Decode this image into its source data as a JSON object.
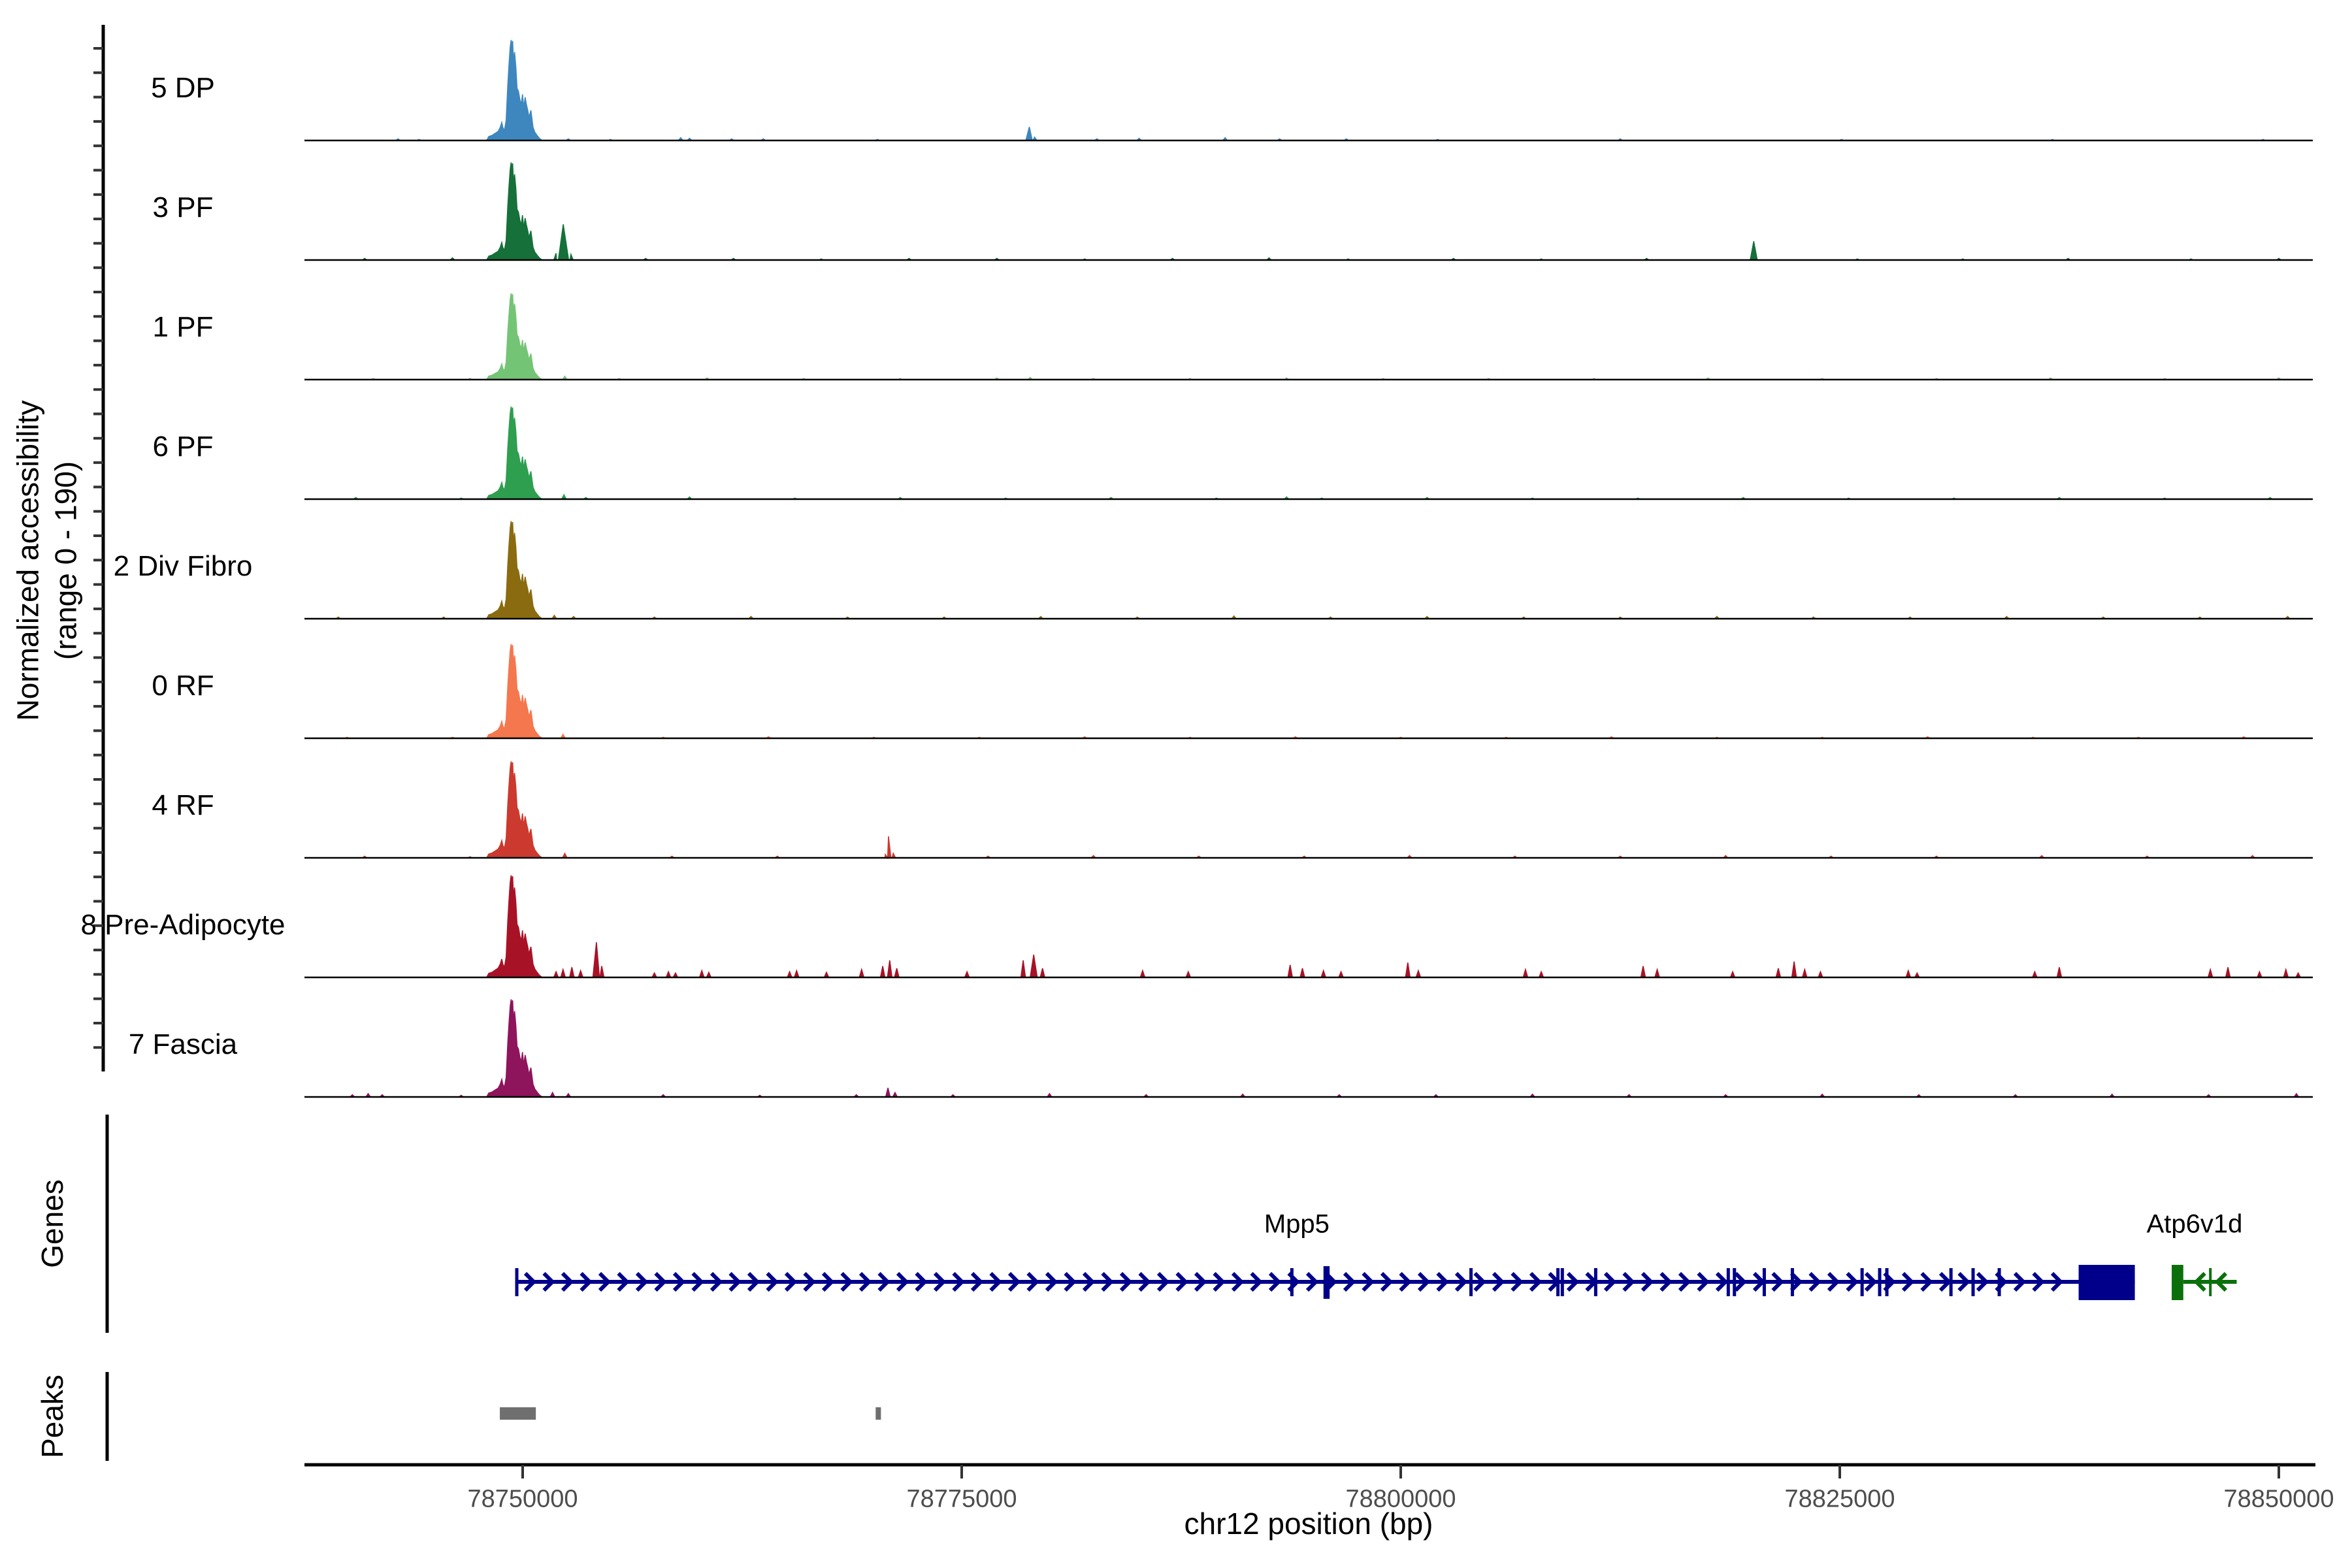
{
  "figure": {
    "background": "#ffffff"
  },
  "y_axis": {
    "title_line1": "Normalized accessibility",
    "title_line2": "(range 0 - 190)",
    "range_min": 0,
    "range_max": 190
  },
  "x_axis": {
    "title": "chr12 position (bp)",
    "tick_labels": [
      "78750000",
      "78775000",
      "78800000",
      "78825000",
      "78850000"
    ]
  },
  "sections": {
    "genes": "Genes",
    "peaks": "Peaks"
  },
  "chart_data": {
    "type": "area",
    "title": "",
    "xlabel": "chr12 position (bp)",
    "ylabel": "Normalized accessibility (range 0 - 190)",
    "xlim": [
      78737574,
      78851934
    ],
    "track_ylim": [
      0,
      190
    ],
    "x_ticks": [
      78750000,
      78775000,
      78800000,
      78825000,
      78850000
    ],
    "grid": false,
    "main_peak_shape": [
      [
        78747950,
        0.0
      ],
      [
        78748070,
        0.04
      ],
      [
        78748250,
        0.05
      ],
      [
        78748420,
        0.07
      ],
      [
        78748600,
        0.09
      ],
      [
        78748720,
        0.13
      ],
      [
        78748810,
        0.18
      ],
      [
        78748870,
        0.13
      ],
      [
        78748960,
        0.1
      ],
      [
        78749060,
        0.2
      ],
      [
        78749150,
        0.55
      ],
      [
        78749220,
        0.75
      ],
      [
        78749290,
        0.93
      ],
      [
        78749340,
        1.0
      ],
      [
        78749390,
        0.95
      ],
      [
        78749430,
        0.99
      ],
      [
        78749470,
        0.8
      ],
      [
        78749540,
        0.88
      ],
      [
        78749610,
        0.74
      ],
      [
        78749680,
        0.52
      ],
      [
        78749760,
        0.49
      ],
      [
        78749840,
        0.41
      ],
      [
        78749920,
        0.36
      ],
      [
        78749990,
        0.46
      ],
      [
        78750060,
        0.33
      ],
      [
        78750140,
        0.43
      ],
      [
        78750210,
        0.36
      ],
      [
        78750290,
        0.3
      ],
      [
        78750360,
        0.23
      ],
      [
        78750470,
        0.3
      ],
      [
        78750590,
        0.13
      ],
      [
        78750700,
        0.08
      ],
      [
        78750820,
        0.05
      ],
      [
        78750960,
        0.02
      ],
      [
        78751110,
        0.0
      ]
    ],
    "tracks": [
      {
        "label": "5 DP",
        "color": "#3d87be",
        "peak_max": 177,
        "extras": [
          [
            78742900,
            3
          ],
          [
            78744100,
            2
          ],
          [
            78752600,
            3
          ],
          [
            78755000,
            2
          ],
          [
            78759000,
            5
          ],
          [
            78759500,
            4
          ],
          [
            78761900,
            3
          ],
          [
            78763700,
            3
          ],
          [
            78770200,
            2
          ],
          [
            78778850,
            24,
            200
          ],
          [
            78779150,
            6
          ],
          [
            78782700,
            3
          ],
          [
            78785100,
            4
          ],
          [
            78790000,
            5
          ],
          [
            78793100,
            3
          ],
          [
            78796900,
            3
          ],
          [
            78802100,
            2
          ],
          [
            78812500,
            3
          ],
          [
            78825100,
            2
          ],
          [
            78837100,
            2
          ],
          [
            78849100,
            2
          ]
        ]
      },
      {
        "label": "3 PF",
        "color": "#15703a",
        "peak_max": 172,
        "extras": [
          [
            78741000,
            3
          ],
          [
            78746000,
            4
          ],
          [
            78751900,
            12
          ],
          [
            78752310,
            63,
            380
          ],
          [
            78752750,
            10
          ],
          [
            78757000,
            3
          ],
          [
            78762000,
            3
          ],
          [
            78767000,
            2
          ],
          [
            78772000,
            3
          ],
          [
            78777000,
            3
          ],
          [
            78782000,
            2
          ],
          [
            78787000,
            3
          ],
          [
            78792500,
            4
          ],
          [
            78797000,
            2
          ],
          [
            78803000,
            3
          ],
          [
            78808000,
            2
          ],
          [
            78814000,
            3
          ],
          [
            78820100,
            33,
            200
          ],
          [
            78826000,
            2
          ],
          [
            78832000,
            2
          ],
          [
            78838000,
            3
          ],
          [
            78845000,
            2
          ],
          [
            78850000,
            3
          ]
        ]
      },
      {
        "label": "1 PF",
        "color": "#74c476",
        "peak_max": 152,
        "extras": [
          [
            78741500,
            2
          ],
          [
            78747000,
            2
          ],
          [
            78752400,
            6
          ],
          [
            78755500,
            2
          ],
          [
            78760500,
            3
          ],
          [
            78766000,
            2
          ],
          [
            78771500,
            2
          ],
          [
            78777000,
            3
          ],
          [
            78778900,
            4
          ],
          [
            78782500,
            2
          ],
          [
            78788000,
            2
          ],
          [
            78793500,
            3
          ],
          [
            78799000,
            2
          ],
          [
            78805000,
            2
          ],
          [
            78811000,
            2
          ],
          [
            78817500,
            3
          ],
          [
            78824000,
            2
          ],
          [
            78830500,
            2
          ],
          [
            78837000,
            3
          ],
          [
            78843500,
            2
          ],
          [
            78850000,
            3
          ]
        ]
      },
      {
        "label": "6 PF",
        "color": "#2e9e4f",
        "peak_max": 163,
        "extras": [
          [
            78740500,
            3
          ],
          [
            78746500,
            2
          ],
          [
            78752350,
            8
          ],
          [
            78753600,
            3
          ],
          [
            78759500,
            4
          ],
          [
            78765500,
            2
          ],
          [
            78771500,
            3
          ],
          [
            78777500,
            2
          ],
          [
            78783500,
            3
          ],
          [
            78789500,
            2
          ],
          [
            78793500,
            4
          ],
          [
            78795500,
            2
          ],
          [
            78801500,
            3
          ],
          [
            78807500,
            2
          ],
          [
            78813500,
            2
          ],
          [
            78819500,
            3
          ],
          [
            78825500,
            2
          ],
          [
            78831500,
            2
          ],
          [
            78837500,
            3
          ],
          [
            78843500,
            2
          ],
          [
            78849500,
            3
          ]
        ]
      },
      {
        "label": "2 Div Fibro",
        "color": "#8a6b10",
        "peak_max": 172,
        "extras": [
          [
            78739500,
            3
          ],
          [
            78745500,
            3
          ],
          [
            78751800,
            6
          ],
          [
            78752900,
            4
          ],
          [
            78757500,
            3
          ],
          [
            78763000,
            4
          ],
          [
            78768500,
            3
          ],
          [
            78774000,
            3
          ],
          [
            78779500,
            4
          ],
          [
            78785000,
            3
          ],
          [
            78790500,
            5
          ],
          [
            78796000,
            3
          ],
          [
            78801500,
            4
          ],
          [
            78807000,
            3
          ],
          [
            78812500,
            3
          ],
          [
            78818000,
            4
          ],
          [
            78823500,
            3
          ],
          [
            78829000,
            3
          ],
          [
            78834500,
            4
          ],
          [
            78840000,
            3
          ],
          [
            78845500,
            3
          ],
          [
            78850500,
            4
          ]
        ]
      },
      {
        "label": "0 RF",
        "color": "#f5774e",
        "peak_max": 166,
        "extras": [
          [
            78740000,
            2
          ],
          [
            78746000,
            2
          ],
          [
            78752300,
            7
          ],
          [
            78758000,
            2
          ],
          [
            78764000,
            3
          ],
          [
            78770000,
            2
          ],
          [
            78776000,
            2
          ],
          [
            78782000,
            3
          ],
          [
            78788000,
            2
          ],
          [
            78794000,
            3
          ],
          [
            78800000,
            2
          ],
          [
            78806000,
            2
          ],
          [
            78812000,
            3
          ],
          [
            78818000,
            2
          ],
          [
            78824000,
            2
          ],
          [
            78830000,
            3
          ],
          [
            78836000,
            2
          ],
          [
            78842000,
            2
          ],
          [
            78848000,
            3
          ]
        ]
      },
      {
        "label": "4 RF",
        "color": "#cc392e",
        "peak_max": 170,
        "extras": [
          [
            78741000,
            3
          ],
          [
            78747000,
            2
          ],
          [
            78752400,
            8
          ],
          [
            78758500,
            3
          ],
          [
            78764500,
            3
          ],
          [
            78770650,
            6
          ],
          [
            78770830,
            38,
            200
          ],
          [
            78771100,
            8
          ],
          [
            78776500,
            3
          ],
          [
            78782500,
            4
          ],
          [
            78788500,
            3
          ],
          [
            78794500,
            3
          ],
          [
            78800500,
            4
          ],
          [
            78806500,
            3
          ],
          [
            78812500,
            3
          ],
          [
            78818500,
            4
          ],
          [
            78824500,
            3
          ],
          [
            78830500,
            3
          ],
          [
            78836500,
            4
          ],
          [
            78842500,
            3
          ],
          [
            78848500,
            4
          ]
        ]
      },
      {
        "label": "8 Pre-Adipocyte",
        "color": "#a81227",
        "peak_max": 180,
        "extras": [
          [
            78751900,
            10
          ],
          [
            78752300,
            14
          ],
          [
            78752800,
            18
          ],
          [
            78753300,
            12
          ],
          [
            78754200,
            62,
            200
          ],
          [
            78754500,
            20
          ],
          [
            78757500,
            8
          ],
          [
            78758300,
            10
          ],
          [
            78758700,
            8
          ],
          [
            78760200,
            12
          ],
          [
            78760600,
            9
          ],
          [
            78765200,
            10
          ],
          [
            78765600,
            12
          ],
          [
            78767300,
            9
          ],
          [
            78769300,
            14
          ],
          [
            78770500,
            20
          ],
          [
            78770900,
            30
          ],
          [
            78771300,
            16
          ],
          [
            78775300,
            10
          ],
          [
            78778500,
            30
          ],
          [
            78779100,
            40,
            200
          ],
          [
            78779600,
            16
          ],
          [
            78785300,
            12
          ],
          [
            78787900,
            10
          ],
          [
            78793700,
            22
          ],
          [
            78794400,
            16
          ],
          [
            78795600,
            12
          ],
          [
            78796600,
            10
          ],
          [
            78800400,
            26
          ],
          [
            78801000,
            12
          ],
          [
            78807100,
            14
          ],
          [
            78808000,
            10
          ],
          [
            78813800,
            20
          ],
          [
            78814600,
            14
          ],
          [
            78818900,
            10
          ],
          [
            78821500,
            16
          ],
          [
            78822400,
            28
          ],
          [
            78823000,
            14
          ],
          [
            78823900,
            10
          ],
          [
            78828900,
            12
          ],
          [
            78829400,
            8
          ],
          [
            78836100,
            10
          ],
          [
            78837500,
            18
          ],
          [
            78846100,
            14
          ],
          [
            78847100,
            18
          ],
          [
            78848900,
            10
          ],
          [
            78850400,
            14
          ],
          [
            78851100,
            8
          ]
        ]
      },
      {
        "label": "7 Fascia",
        "color": "#8e145c",
        "peak_max": 172,
        "extras": [
          [
            78740300,
            4
          ],
          [
            78741200,
            6
          ],
          [
            78742000,
            4
          ],
          [
            78746500,
            3
          ],
          [
            78751700,
            8
          ],
          [
            78752600,
            6
          ],
          [
            78758000,
            4
          ],
          [
            78763500,
            3
          ],
          [
            78769000,
            4
          ],
          [
            78770800,
            16
          ],
          [
            78771200,
            8
          ],
          [
            78774500,
            4
          ],
          [
            78780000,
            6
          ],
          [
            78785500,
            4
          ],
          [
            78791000,
            5
          ],
          [
            78796500,
            4
          ],
          [
            78802000,
            4
          ],
          [
            78807500,
            5
          ],
          [
            78813000,
            4
          ],
          [
            78818500,
            4
          ],
          [
            78824000,
            5
          ],
          [
            78829500,
            4
          ],
          [
            78835000,
            4
          ],
          [
            78840500,
            5
          ],
          [
            78846000,
            4
          ],
          [
            78851000,
            6
          ]
        ]
      }
    ],
    "genes": [
      {
        "name": "Mpp5",
        "strand": "+",
        "color": "#00008b",
        "start": 78749665,
        "body_end": 78838600,
        "exon_box": {
          "start": 78838600,
          "end": 78841800
        },
        "small_exon_box": {
          "start": 78795600,
          "end": 78795950
        },
        "exon_ticks": [
          78749665,
          78793800,
          78804000,
          78808950,
          78809200,
          78811100,
          78818650,
          78819000,
          78820700,
          78822300,
          78826270,
          78827270,
          78827680,
          78831330,
          78832590,
          78834080
        ],
        "label_bp": 78794080
      },
      {
        "name": "Atp6v1d",
        "strand": "-",
        "color": "#0b700b",
        "exon_box": {
          "start": 78843900,
          "end": 78844560
        },
        "line_start": 78844560,
        "line_end": 78847600,
        "exon_ticks": [
          78846100
        ],
        "arrow_bps": [
          78845300,
          78846500
        ],
        "label_bp": 78845200
      }
    ],
    "peaks": [
      {
        "start": 78748700,
        "end": 78750750
      },
      {
        "start": 78770100,
        "end": 78770400
      }
    ],
    "peak_color": "#6f6f6f"
  }
}
